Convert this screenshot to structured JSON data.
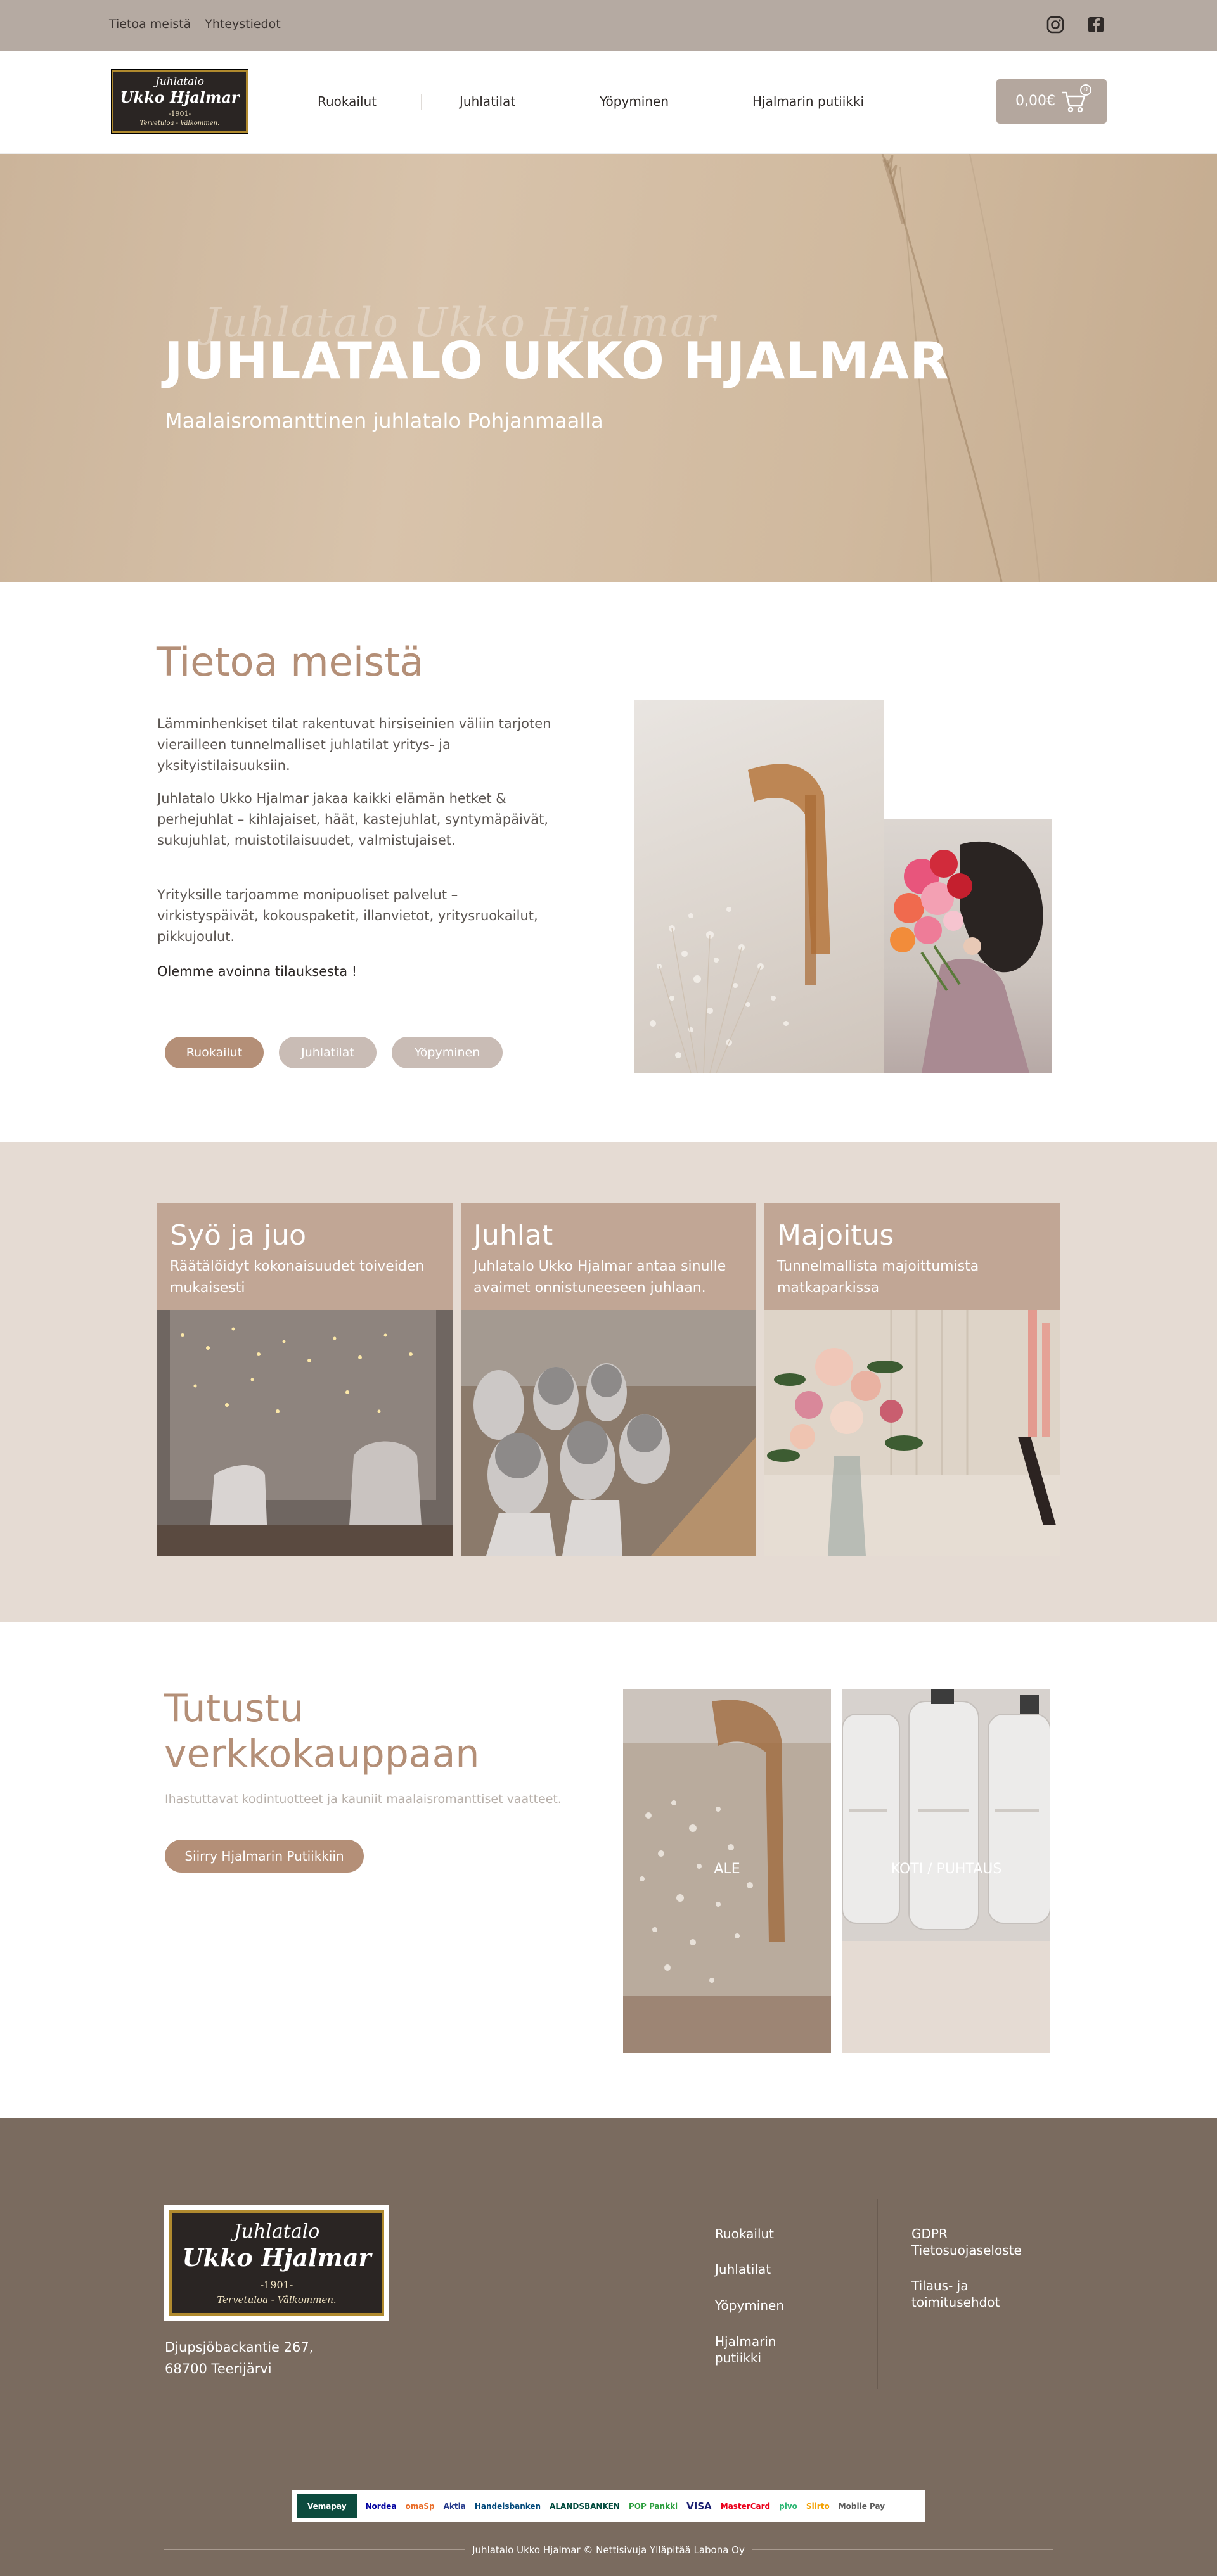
{
  "topbar": {
    "links": [
      "Tietoa meistä",
      "Yhteystiedot"
    ],
    "social_icons": [
      "instagram-icon",
      "facebook-icon"
    ]
  },
  "header": {
    "logo": {
      "line1": "Juhlatalo",
      "line2": "Ukko Hjalmar",
      "line3": "-1901-",
      "line4": "Tervetuloa - Välkommen."
    },
    "nav": [
      "Ruokailut",
      "Juhlatilat",
      "Yöpyminen",
      "Hjalmarin putiikki"
    ],
    "cart": {
      "amount": "0,00€",
      "count": "0",
      "icon": "cart-icon"
    }
  },
  "hero": {
    "script_text": "Juhlatalo Ukko Hjalmar",
    "title": "JUHLATALO UKKO HJALMAR",
    "subtitle": "Maalaisromanttinen juhlatalo Pohjanmaalla"
  },
  "about": {
    "title": "Tietoa meistä",
    "paragraphs": [
      "Lämminhenkiset tilat rakentuvat hirsiseinien väliin tarjoten vierailleen tunnelmalliset juhlatilat yritys- ja yksityistilaisuuksiin.",
      "Juhlatalo Ukko Hjalmar jakaa kaikki elämän hetket & perhejuhlat – kihlajaiset, häät, kastejuhlat, syntymäpäivät, sukujuhlat, muistotilaisuudet, valmistujaiset.",
      "Yrityksille tarjoamme monipuoliset palvelut – virkistyspäivät, kokouspaketit, illanvietot, yritysruokailut, pikkujoulut."
    ],
    "open_text": "Olemme avoinna tilauksesta !",
    "buttons": [
      "Ruokailut",
      "Juhlatilat",
      "Yöpyminen"
    ]
  },
  "services": [
    {
      "title": "Syö ja juo",
      "desc": "Räätälöidyt kokonaisuudet toiveiden mukaisesti"
    },
    {
      "title": "Juhlat",
      "desc": "Juhlatalo Ukko Hjalmar antaa sinulle avaimet onnistuneeseen juhlaan."
    },
    {
      "title": "Majoitus",
      "desc": "Tunnelmallista majoittumista matkaparkissa"
    }
  ],
  "shop": {
    "title": "Tutustu verkkokauppaan",
    "desc": "Ihastuttavat kodintuotteet ja kauniit maalaisromanttiset vaatteet.",
    "button": "Siirry Hjalmarin Putiikkiin",
    "tiles": [
      "ALE",
      "KOTI / PUHTAUS"
    ]
  },
  "footer": {
    "logo": {
      "line1": "Juhlatalo",
      "line2": "Ukko Hjalmar",
      "line3": "-1901-",
      "line4": "Tervetuloa - Välkommen."
    },
    "address_line1": "Djupsjöbackantie 267,",
    "address_line2": "68700 Teerijärvi",
    "nav": [
      "Ruokailut",
      "Juhlatilat",
      "Yöpyminen",
      "Hjalmarin putiikki"
    ],
    "legal": [
      "GDPR Tietosuojaseloste",
      "Tilaus- ja toimitusehdot"
    ],
    "payments": [
      "Vemapay",
      "Nordea",
      "omaSp",
      "Aktia",
      "Handelsbanken",
      "ALANDSBANKEN",
      "POP Pankki",
      "VISA",
      "MasterCard",
      "pivo",
      "Siirto",
      "Mobile Pay"
    ],
    "copyright": "Juhlatalo Ukko Hjalmar © Nettisivuja Ylläpitää Labona Oy"
  },
  "colors": {
    "accent": "#b48f77",
    "topbar": "#b5aaa2",
    "services_bg": "#e5dbd3",
    "card_band": "#c1a695",
    "footer": "#7a6b5f"
  }
}
